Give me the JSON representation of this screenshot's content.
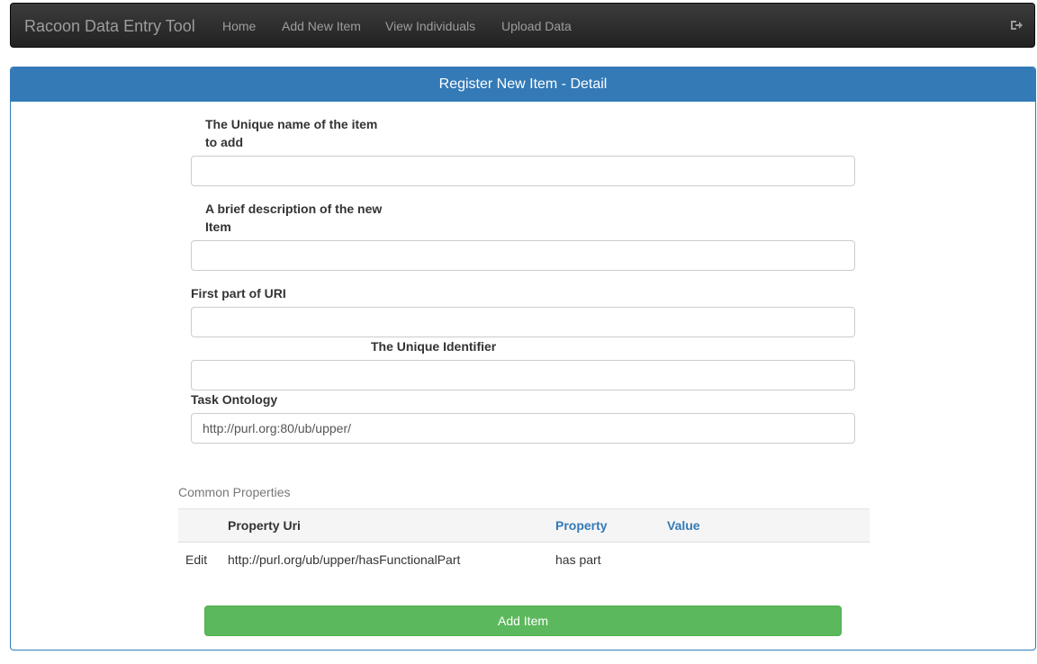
{
  "navbar": {
    "brand": "Racoon Data Entry Tool",
    "links": [
      "Home",
      "Add New Item",
      "View Individuals",
      "Upload Data"
    ],
    "logout_icon": "sign-out-icon"
  },
  "panel": {
    "title": "Register New Item - Detail"
  },
  "form": {
    "name_label": "The Unique name of the item to add",
    "name_label_line1": "The Unique name of the item",
    "name_label_line2": "to add",
    "name_value": "",
    "desc_label_line1": "A brief description of the new",
    "desc_label_line2": "Item",
    "desc_value": "",
    "uri_label": "First part of URI",
    "uri_value": "",
    "identifier_label": "The Unique Identifier",
    "identifier_value": "",
    "ontology_label": "Task Ontology",
    "ontology_value": "http://purl.org:80/ub/upper/"
  },
  "properties": {
    "caption": "Common Properties",
    "headers": [
      "",
      "Property Uri",
      "Property",
      "Value"
    ],
    "rows": [
      {
        "action": "Edit",
        "uri": "http://purl.org/ub/upper/hasFunctionalPart",
        "property": "has part",
        "value": ""
      }
    ]
  },
  "actions": {
    "add_label": "Add Item"
  },
  "colors": {
    "primary": "#337ab7",
    "success": "#5cb85c",
    "navbar": "#222222"
  }
}
